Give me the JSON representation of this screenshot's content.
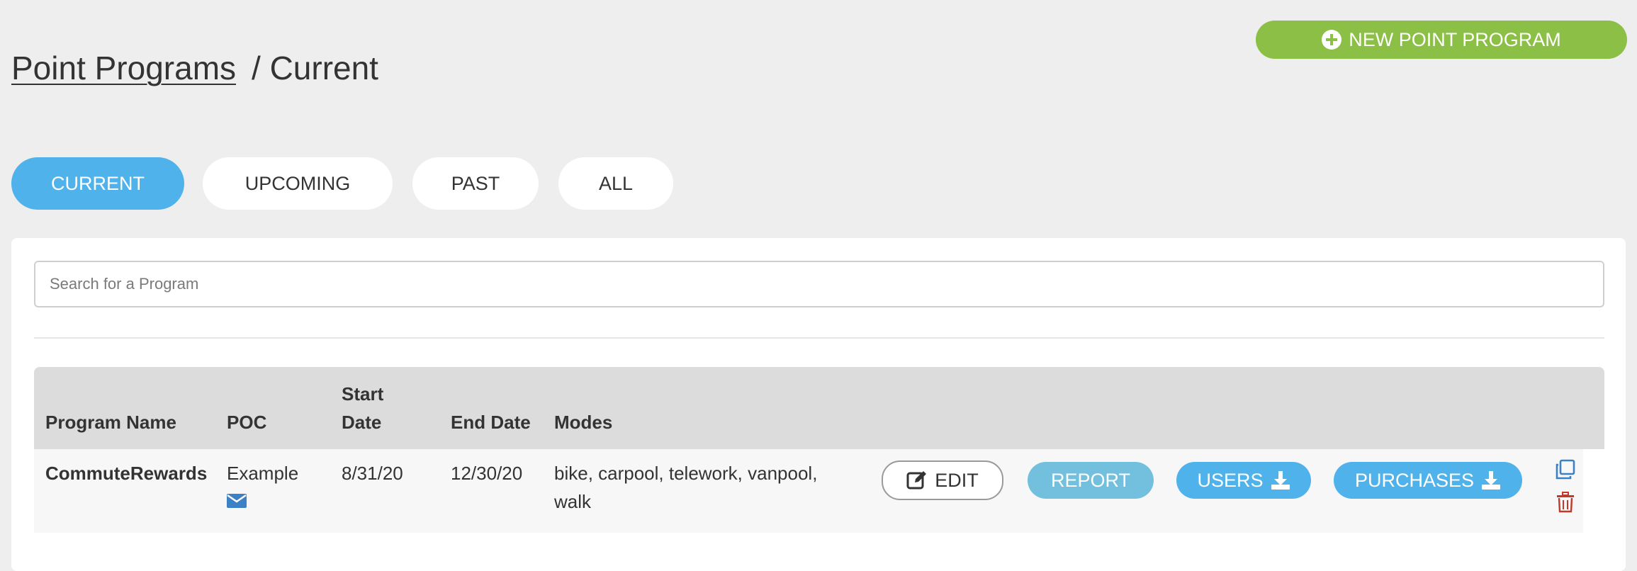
{
  "header": {
    "new_program_label": "NEW POINT PROGRAM",
    "breadcrumb_link": "Point Programs",
    "breadcrumb_current": "/ Current"
  },
  "tabs": [
    {
      "label": "CURRENT",
      "active": true
    },
    {
      "label": "UPCOMING",
      "active": false
    },
    {
      "label": "PAST",
      "active": false
    },
    {
      "label": "ALL",
      "active": false
    }
  ],
  "search": {
    "placeholder": "Search for a Program",
    "value": ""
  },
  "table": {
    "columns": {
      "program_name": "Program Name",
      "poc": "POC",
      "start_date_line1": "Start",
      "start_date_line2": "Date",
      "end_date": "End Date",
      "modes": "Modes"
    },
    "rows": [
      {
        "program_name": "CommuteRewards",
        "poc": "Example",
        "start_date": "8/31/20",
        "end_date": "12/30/20",
        "modes_line1": "bike, carpool, telework, vanpool,",
        "modes_line2": "walk",
        "actions": {
          "edit": "EDIT",
          "report": "REPORT",
          "users": "USERS",
          "purchases": "PURCHASES"
        }
      }
    ]
  },
  "colors": {
    "accent_green": "#8cbf45",
    "accent_blue": "#4fb2ea",
    "report_blue": "#72c0de",
    "delete_red": "#c0392b",
    "copy_blue": "#3c80c6"
  },
  "icons": [
    "plus-circle-icon",
    "pencil-square-icon",
    "envelope-icon",
    "download-icon",
    "copy-icon",
    "trash-icon"
  ]
}
